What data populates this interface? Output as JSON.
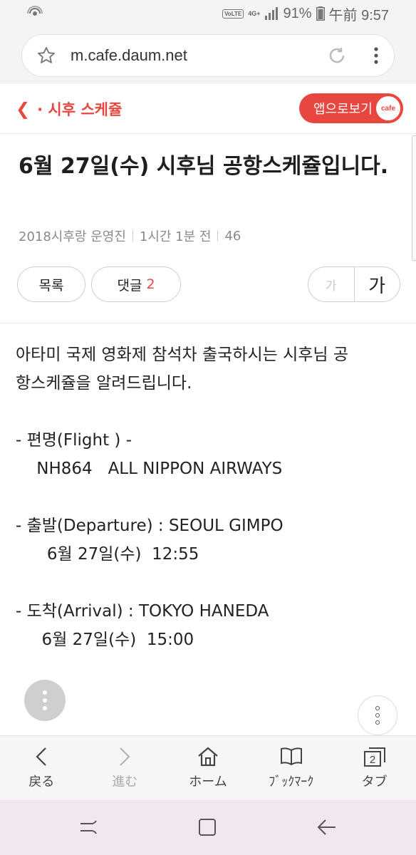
{
  "status": {
    "volte": "VoLTE",
    "network": "4G+",
    "battery": "91%",
    "time": "午前 9:57"
  },
  "browser": {
    "url": "m.cafe.daum.net"
  },
  "cafe_header": {
    "back_label": "· 시후 스케쥴",
    "app_button": "앱으로보기",
    "badge": "cafe"
  },
  "post": {
    "title": "6월 27일(수) 시후님 공항스케쥴입니다.",
    "author": "2018시후랑 운영진",
    "time_ago": "1시간 1분 전",
    "views": "46",
    "list_button": "목록",
    "comments_label": "댓글",
    "comments_count": "2",
    "font_small": "가",
    "font_large": "가"
  },
  "body": {
    "line1": "아타미 국제 영화제 참석차 출국하시는 시후님 공",
    "line2": "항스케쥴을 알려드립니다.",
    "flight_label": "- 편명(Flight ) -",
    "flight_value": "    NH864   ALL NIPPON AIRWAYS",
    "departure_label": "- 출발(Departure) : SEOUL GIMPO",
    "departure_time": "      6월 27일(수)  12:55",
    "arrival_label": "- 도착(Arrival) : TOKYO HANEDA",
    "arrival_time": "     6월 27일(수)  15:00"
  },
  "toolbar": {
    "back": "戻る",
    "forward": "進む",
    "home": "ホーム",
    "bookmarks": "ﾌﾞｯｸﾏｰｸ",
    "tabs": "タブ",
    "tab_count": "2"
  },
  "colors": {
    "accent": "#e8473f",
    "nav_bar": "#f2e6f0"
  }
}
